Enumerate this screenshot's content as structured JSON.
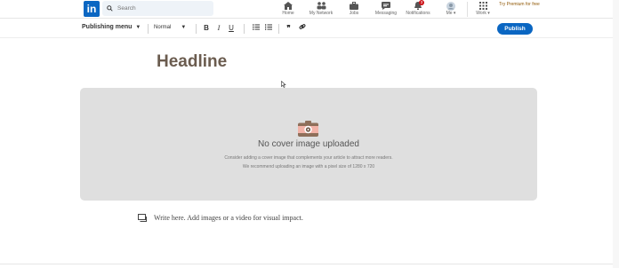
{
  "nav": {
    "logo_text": "in",
    "search_placeholder": "Search",
    "items": [
      {
        "label": "Home",
        "icon": "home-icon"
      },
      {
        "label": "My Network",
        "icon": "network-icon"
      },
      {
        "label": "Jobs",
        "icon": "briefcase-icon"
      },
      {
        "label": "Messaging",
        "icon": "messaging-icon"
      },
      {
        "label": "Notifications",
        "icon": "bell-icon",
        "badge": "3"
      },
      {
        "label": "Me",
        "icon": "avatar"
      },
      {
        "label": "Work",
        "icon": "grid-icon"
      }
    ],
    "premium": "Try Premium for free"
  },
  "toolbar": {
    "publishing_menu": "Publishing menu",
    "style": "Normal",
    "bold": "B",
    "italic": "I",
    "underline": "U",
    "quote": "❞",
    "publish": "Publish"
  },
  "editor": {
    "headline": "Headline",
    "cover_title": "No cover image uploaded",
    "cover_line1": "Consider adding a cover image that complements your article to attract more readers.",
    "cover_line2": "We recommend uploading an image with a pixel size of 1280 x 720",
    "write_placeholder": "Write here. Add images or a video for visual impact."
  },
  "colors": {
    "brand": "#0a66c2",
    "premium": "#915907",
    "badge": "#cc1016"
  }
}
